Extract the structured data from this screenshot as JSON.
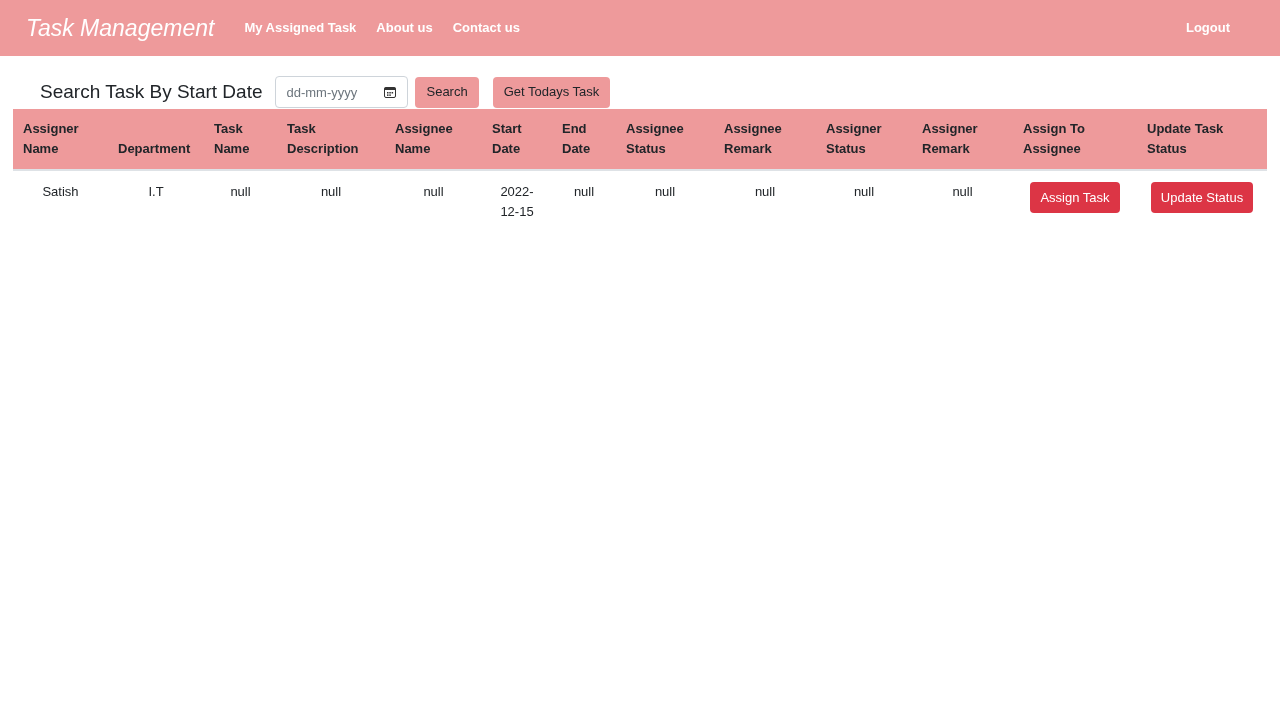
{
  "navbar": {
    "brand": "Task Management",
    "links": [
      "My Assigned Task",
      "About us",
      "Contact us"
    ],
    "logout": "Logout"
  },
  "search": {
    "heading": "Search Task By Start Date",
    "date_field": {
      "placeholder": "dd-mm-yyyy"
    },
    "buttons": [
      "Search",
      "Get Todays Task"
    ]
  },
  "table": {
    "columns": [
      "Assigner Name",
      "Department",
      "Task Name",
      "Task Description",
      "Assignee Name",
      "Start Date",
      "End Date",
      "Assignee Status",
      "Assignee Remark",
      "Assigner Status",
      "Assigner Remark",
      "Assign To Assignee",
      "Update Task Status"
    ],
    "rows": [
      {
        "cells": [
          {
            "kind": "text",
            "text": "Satish"
          },
          {
            "kind": "text",
            "text": "I.T"
          },
          {
            "kind": "text",
            "text": "null"
          },
          {
            "kind": "text",
            "text": "null"
          },
          {
            "kind": "text",
            "text": "null"
          },
          {
            "kind": "text",
            "text": "2022-12-15"
          },
          {
            "kind": "text",
            "text": "null"
          },
          {
            "kind": "text",
            "text": "null"
          },
          {
            "kind": "text",
            "text": "null"
          },
          {
            "kind": "text",
            "text": "null"
          },
          {
            "kind": "text",
            "text": "null"
          },
          {
            "kind": "button",
            "text": "Assign Task"
          },
          {
            "kind": "button",
            "text": "Update Status"
          }
        ]
      }
    ]
  }
}
